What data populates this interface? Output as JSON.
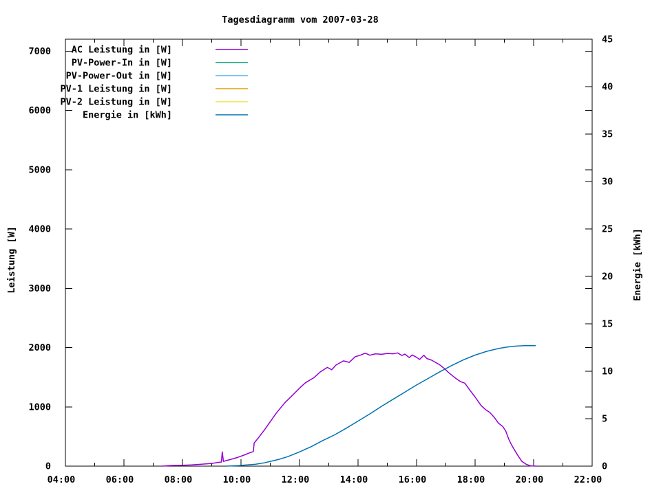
{
  "chart_data": {
    "type": "line",
    "title": "Tagesdiagramm vom 2007-03-28",
    "ylabel": "Leistung [W]",
    "y2label": "Energie [kWh]",
    "xlim_hours": [
      4,
      22
    ],
    "ylim": [
      0,
      7200
    ],
    "y2lim": [
      0,
      45
    ],
    "grid": false,
    "legend_position": "top-left-inside",
    "x_ticks": [
      {
        "t": 4,
        "label": "04:00"
      },
      {
        "t": 6,
        "label": "06:00"
      },
      {
        "t": 8,
        "label": "08:00"
      },
      {
        "t": 10,
        "label": "10:00"
      },
      {
        "t": 12,
        "label": "12:00"
      },
      {
        "t": 14,
        "label": "14:00"
      },
      {
        "t": 16,
        "label": "16:00"
      },
      {
        "t": 18,
        "label": "18:00"
      },
      {
        "t": 20,
        "label": "20:00"
      },
      {
        "t": 22,
        "label": "22:00"
      }
    ],
    "x_minor_ticks": [
      5,
      7,
      9,
      11,
      13,
      15,
      17,
      19,
      21
    ],
    "y_ticks": [
      {
        "v": 0,
        "label": "0"
      },
      {
        "v": 1000,
        "label": "1000"
      },
      {
        "v": 2000,
        "label": "2000"
      },
      {
        "v": 3000,
        "label": "3000"
      },
      {
        "v": 4000,
        "label": "4000"
      },
      {
        "v": 5000,
        "label": "5000"
      },
      {
        "v": 6000,
        "label": "6000"
      },
      {
        "v": 7000,
        "label": "7000"
      }
    ],
    "y2_ticks": [
      {
        "v": 0,
        "label": "0"
      },
      {
        "v": 5,
        "label": "5"
      },
      {
        "v": 10,
        "label": "10"
      },
      {
        "v": 15,
        "label": "15"
      },
      {
        "v": 20,
        "label": "20"
      },
      {
        "v": 25,
        "label": "25"
      },
      {
        "v": 30,
        "label": "30"
      },
      {
        "v": 35,
        "label": "35"
      },
      {
        "v": 40,
        "label": "40"
      },
      {
        "v": 45,
        "label": "45"
      }
    ],
    "series": [
      {
        "key": "ac-leistung",
        "name": "AC Leistung in [W]",
        "color": "#9400d3",
        "axis": "y1",
        "points": [
          [
            7.3,
            0
          ],
          [
            7.6,
            10
          ],
          [
            8.0,
            15
          ],
          [
            8.3,
            20
          ],
          [
            8.6,
            30
          ],
          [
            9.0,
            45
          ],
          [
            9.2,
            60
          ],
          [
            9.33,
            70
          ],
          [
            9.36,
            240
          ],
          [
            9.4,
            80
          ],
          [
            9.7,
            120
          ],
          [
            9.9,
            150
          ],
          [
            10.1,
            185
          ],
          [
            10.3,
            225
          ],
          [
            10.42,
            245
          ],
          [
            10.45,
            390
          ],
          [
            10.6,
            480
          ],
          [
            10.8,
            610
          ],
          [
            11.0,
            750
          ],
          [
            11.2,
            890
          ],
          [
            11.5,
            1070
          ],
          [
            11.8,
            1215
          ],
          [
            12.0,
            1315
          ],
          [
            12.2,
            1405
          ],
          [
            12.5,
            1495
          ],
          [
            12.7,
            1585
          ],
          [
            12.95,
            1665
          ],
          [
            13.1,
            1625
          ],
          [
            13.25,
            1705
          ],
          [
            13.5,
            1775
          ],
          [
            13.7,
            1750
          ],
          [
            13.9,
            1845
          ],
          [
            14.1,
            1875
          ],
          [
            14.25,
            1905
          ],
          [
            14.4,
            1870
          ],
          [
            14.6,
            1895
          ],
          [
            14.8,
            1885
          ],
          [
            15.0,
            1900
          ],
          [
            15.2,
            1895
          ],
          [
            15.35,
            1910
          ],
          [
            15.5,
            1865
          ],
          [
            15.6,
            1890
          ],
          [
            15.75,
            1830
          ],
          [
            15.85,
            1875
          ],
          [
            16.0,
            1835
          ],
          [
            16.1,
            1800
          ],
          [
            16.25,
            1870
          ],
          [
            16.35,
            1815
          ],
          [
            16.5,
            1790
          ],
          [
            16.65,
            1750
          ],
          [
            16.8,
            1705
          ],
          [
            16.95,
            1645
          ],
          [
            17.1,
            1575
          ],
          [
            17.3,
            1495
          ],
          [
            17.5,
            1425
          ],
          [
            17.65,
            1400
          ],
          [
            17.8,
            1295
          ],
          [
            18.0,
            1165
          ],
          [
            18.2,
            1025
          ],
          [
            18.35,
            955
          ],
          [
            18.5,
            905
          ],
          [
            18.65,
            825
          ],
          [
            18.8,
            725
          ],
          [
            18.95,
            665
          ],
          [
            19.05,
            590
          ],
          [
            19.15,
            455
          ],
          [
            19.25,
            355
          ],
          [
            19.4,
            230
          ],
          [
            19.5,
            150
          ],
          [
            19.6,
            80
          ],
          [
            19.75,
            30
          ],
          [
            19.9,
            5
          ],
          [
            20.1,
            0
          ]
        ]
      },
      {
        "key": "pv-power-in",
        "name": "PV-Power-In in [W]",
        "color": "#009e73",
        "axis": "y1",
        "points": []
      },
      {
        "key": "pv-power-out",
        "name": "PV-Power-Out in [W]",
        "color": "#56b4e9",
        "axis": "y1",
        "points": []
      },
      {
        "key": "pv-1-leistung",
        "name": "PV-1 Leistung in [W]",
        "color": "#e69f00",
        "axis": "y1",
        "points": []
      },
      {
        "key": "pv-2-leistung",
        "name": "PV-2 Leistung in [W]",
        "color": "#f0e442",
        "axis": "y1",
        "points": []
      },
      {
        "key": "energie",
        "name": "Energie in [kWh]",
        "color": "#0072b2",
        "axis": "y2",
        "points": [
          [
            9.5,
            0.0
          ],
          [
            9.9,
            0.05
          ],
          [
            10.2,
            0.12
          ],
          [
            10.5,
            0.2
          ],
          [
            10.8,
            0.35
          ],
          [
            11.0,
            0.5
          ],
          [
            11.3,
            0.72
          ],
          [
            11.6,
            1.0
          ],
          [
            12.0,
            1.5
          ],
          [
            12.4,
            2.05
          ],
          [
            12.8,
            2.7
          ],
          [
            13.2,
            3.3
          ],
          [
            13.6,
            4.0
          ],
          [
            14.0,
            4.75
          ],
          [
            14.4,
            5.5
          ],
          [
            14.8,
            6.3
          ],
          [
            15.2,
            7.05
          ],
          [
            15.6,
            7.8
          ],
          [
            16.0,
            8.55
          ],
          [
            16.4,
            9.25
          ],
          [
            16.8,
            9.95
          ],
          [
            17.2,
            10.6
          ],
          [
            17.6,
            11.2
          ],
          [
            18.0,
            11.7
          ],
          [
            18.4,
            12.1
          ],
          [
            18.8,
            12.4
          ],
          [
            19.1,
            12.55
          ],
          [
            19.4,
            12.65
          ],
          [
            19.7,
            12.7
          ],
          [
            20.07,
            12.7
          ]
        ]
      }
    ]
  }
}
